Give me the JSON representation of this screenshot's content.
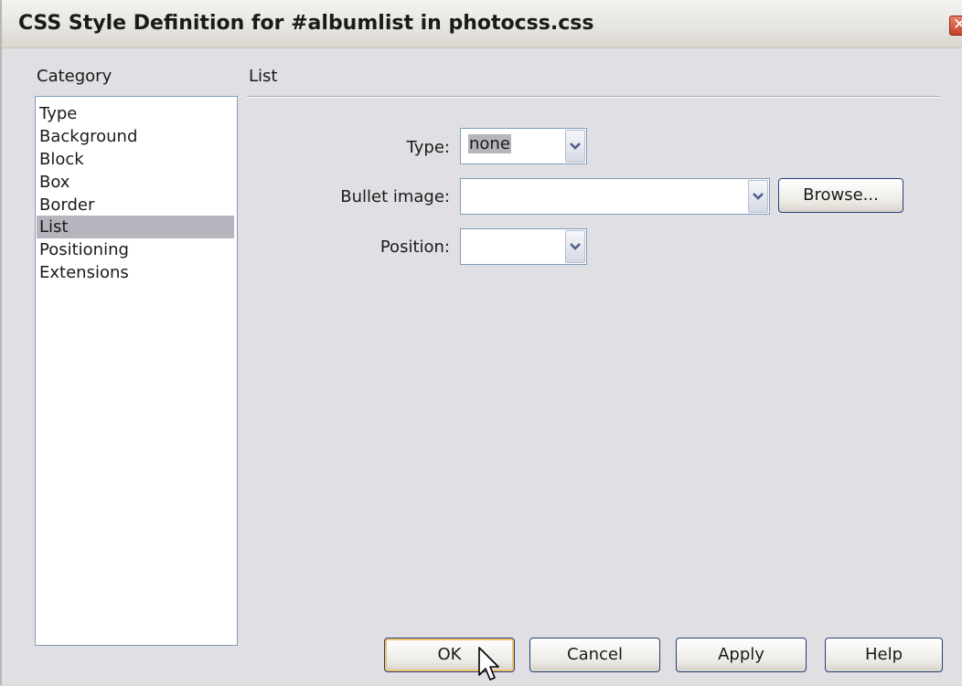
{
  "window": {
    "title": "CSS Style Definition for #albumlist in photocss.css",
    "close_glyph": "✕"
  },
  "category": {
    "heading": "Category",
    "items": [
      "Type",
      "Background",
      "Block",
      "Box",
      "Border",
      "List",
      "Positioning",
      "Extensions"
    ],
    "selected": "List"
  },
  "panel": {
    "heading": "List",
    "fields": {
      "type_label": "Type:",
      "type_value": "none",
      "bullet_label": "Bullet image:",
      "bullet_value": "",
      "position_label": "Position:",
      "position_value": ""
    },
    "browse_label": "Browse..."
  },
  "footer": {
    "ok_label": "OK",
    "cancel_label": "Cancel",
    "apply_label": "Apply",
    "help_label": "Help"
  },
  "colors": {
    "selection": "#b6b4bc",
    "dialog_bg": "#e0dfe3",
    "close_red": "#c8412a"
  }
}
